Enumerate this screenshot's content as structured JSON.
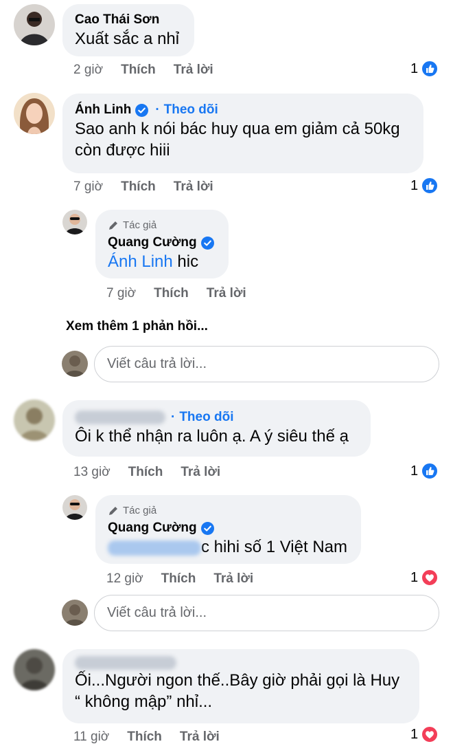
{
  "labels": {
    "like": "Thích",
    "reply": "Trả lời",
    "author": "Tác giả",
    "follow": "Theo dõi",
    "dot": "·",
    "reply_placeholder": "Viết câu trả lời...",
    "see_more": "Xem thêm 1 phản hồi..."
  },
  "comments": [
    {
      "name": "Cao Thái Sơn",
      "text": "Xuất sắc a nhỉ",
      "time": "2 giờ",
      "reactions": "1",
      "reaction_type": "like"
    },
    {
      "name": "Ánh Linh",
      "verified": true,
      "text_line1": "Sao anh k nói bác huy qua em giảm cả 50kg",
      "text_line2": "còn được hiii",
      "time": "7 giờ",
      "reactions": "1",
      "reaction_type": "like",
      "reply": {
        "name": "Quang Cường",
        "verified": true,
        "mention": "Ánh Linh",
        "text": " hic",
        "time": "7 giờ"
      }
    },
    {
      "name": "",
      "text": "Ôi k thể nhận ra luôn ạ. A ý siêu thế ạ",
      "time": "13 giờ",
      "reactions": "1",
      "reaction_type": "like",
      "reply": {
        "name": "Quang Cường",
        "verified": true,
        "text": "c hihi số 1 Việt Nam",
        "time": "12 giờ",
        "reactions": "1",
        "reaction_type": "love"
      }
    },
    {
      "name": "",
      "text_line1": "Ối...Người ngon thế..Bây giờ phải gọi là Huy",
      "text_line2": "“ không mập” nhỉ...",
      "time": "11 giờ",
      "reactions": "1",
      "reaction_type": "love"
    }
  ],
  "colors": {
    "accent": "#1877f2",
    "bubble": "#f0f2f5",
    "love": "#f33e58",
    "muted": "#65676b"
  }
}
